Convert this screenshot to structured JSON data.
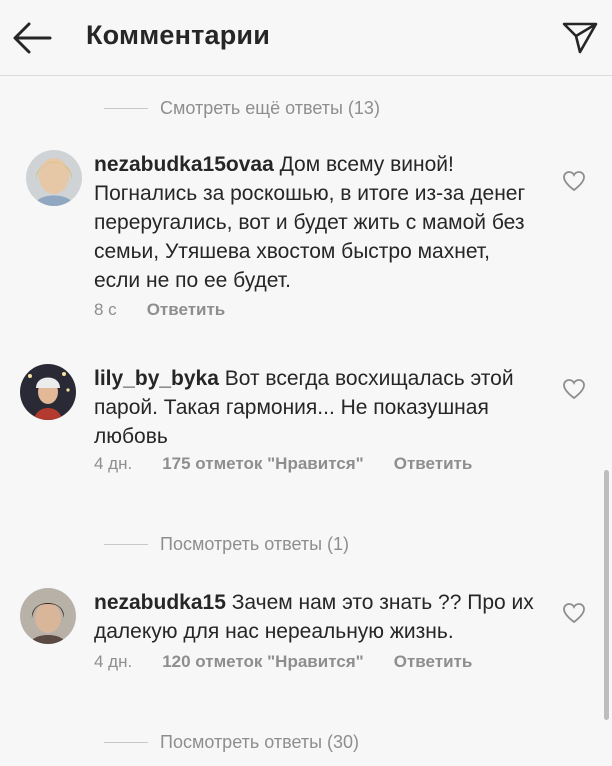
{
  "header": {
    "title": "Комментарии",
    "back_icon": "arrow-left-icon",
    "share_icon": "paper-plane-icon"
  },
  "more_replies_top": "Смотреть ещё ответы (13)",
  "comments": [
    {
      "username": "nezabudka15ovaa",
      "text_line1": " Дом всему виной!",
      "text_rest": "Погнались за роскошью, в итоге из-за денег переругались, вот и будет жить с мамой без семьи, Утяшева хвостом быстро махнет, если не по ее будет.",
      "time": "8 с",
      "reply": "Ответить"
    },
    {
      "username": "lily_by_byka",
      "text_line1": " Вот всегда восхищалась",
      "text_rest": "этой парой. Такая гармония... Не показушная любовь",
      "time": "4 дн.",
      "likes": "175 отметок \"Нравится\"",
      "reply": "Ответить"
    },
    {
      "username": "nezabudka15",
      "text_line1": " Зачем нам это знать ?? Про",
      "text_rest": "их далекую для нас нереальную жизнь.",
      "time": "4 дн.",
      "likes": "120 отметок \"Нравится\"",
      "reply": "Ответить"
    }
  ],
  "view_replies_1": "Посмотреть ответы (1)",
  "view_replies_2": "Посмотреть ответы (30)",
  "colors": {
    "text": "#262626",
    "secondary": "#8e8e8e",
    "background": "#f7f7f7"
  }
}
